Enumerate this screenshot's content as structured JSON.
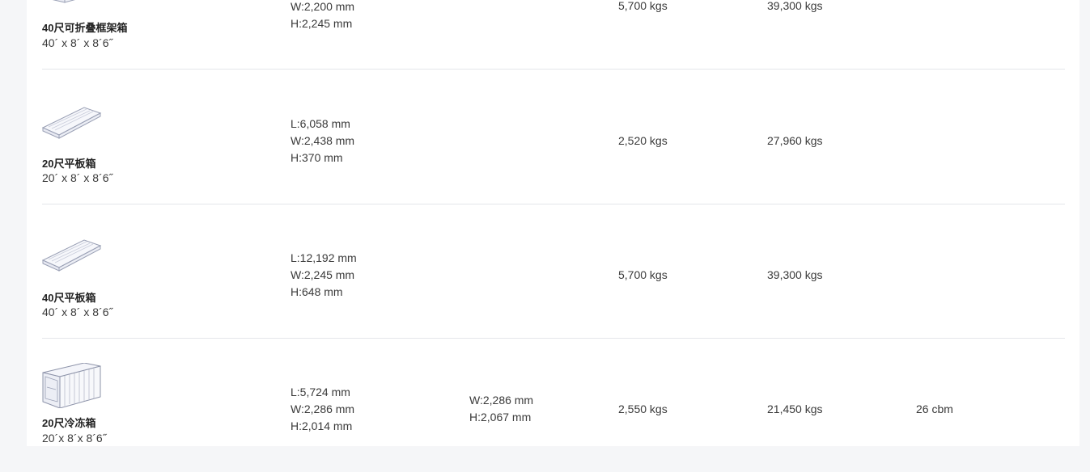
{
  "rows": [
    {
      "name": "40尺可折叠框架箱",
      "size": "40´ x 8´ x 8´6˝",
      "icon": "folding-flat-rack-container-icon",
      "dims": [
        "W:2,200 mm",
        "H:2,245 mm"
      ],
      "door": [],
      "tare": "5,700 kgs",
      "payload": "39,300 kgs",
      "capacity": ""
    },
    {
      "name": "20尺平板箱",
      "size": "20´ x 8´ x 8´6˝",
      "icon": "platform-container-icon",
      "dims": [
        "L:6,058 mm",
        "W:2,438 mm",
        "H:370 mm"
      ],
      "door": [],
      "tare": "2,520 kgs",
      "payload": "27,960 kgs",
      "capacity": ""
    },
    {
      "name": "40尺平板箱",
      "size": "40´ x 8´ x 8´6˝",
      "icon": "platform-container-icon",
      "dims": [
        "L:12,192 mm",
        "W:2,245 mm",
        "H:648 mm"
      ],
      "door": [],
      "tare": "5,700 kgs",
      "payload": "39,300 kgs",
      "capacity": ""
    },
    {
      "name": "20尺冷冻箱",
      "size": "20´x 8´x 8´6˝",
      "icon": "reefer-container-icon",
      "dims": [
        "L:5,724 mm",
        "W:2,286 mm",
        "H:2,014 mm"
      ],
      "door": [
        "W:2,286 mm",
        "H:2,067 mm"
      ],
      "tare": "2,550 kgs",
      "payload": "21,450 kgs",
      "capacity": "26 cbm"
    }
  ]
}
